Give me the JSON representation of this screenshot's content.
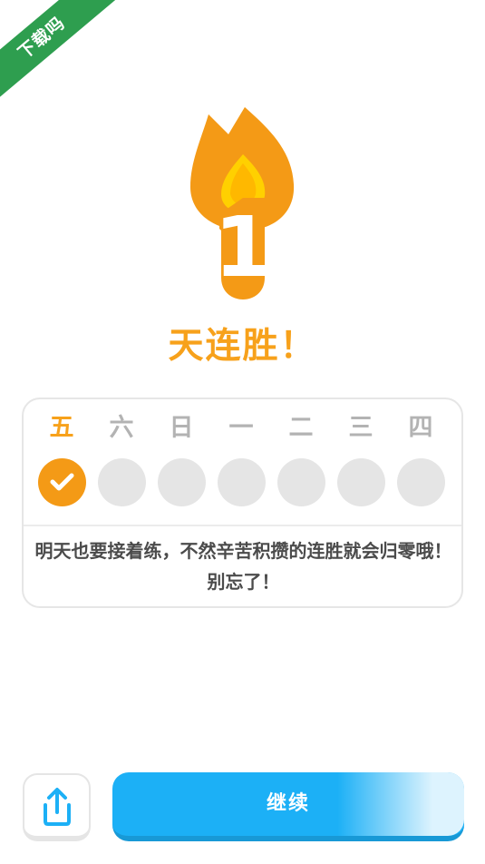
{
  "watermark": {
    "label": "下载吗"
  },
  "streak": {
    "count": "1",
    "title": "天连胜！"
  },
  "week": {
    "days": [
      {
        "label": "五",
        "done": true
      },
      {
        "label": "六",
        "done": false
      },
      {
        "label": "日",
        "done": false
      },
      {
        "label": "一",
        "done": false
      },
      {
        "label": "二",
        "done": false
      },
      {
        "label": "三",
        "done": false
      },
      {
        "label": "四",
        "done": false
      }
    ],
    "reminder": "明天也要接着练，不然辛苦积攒的连胜就会归零哦！别忘了！"
  },
  "footer": {
    "share_icon": "share-icon",
    "continue_label": "继续"
  },
  "colors": {
    "accent_orange": "#f7a11b",
    "button_blue": "#1cb0f6",
    "ribbon_green": "#2e9e4f"
  }
}
